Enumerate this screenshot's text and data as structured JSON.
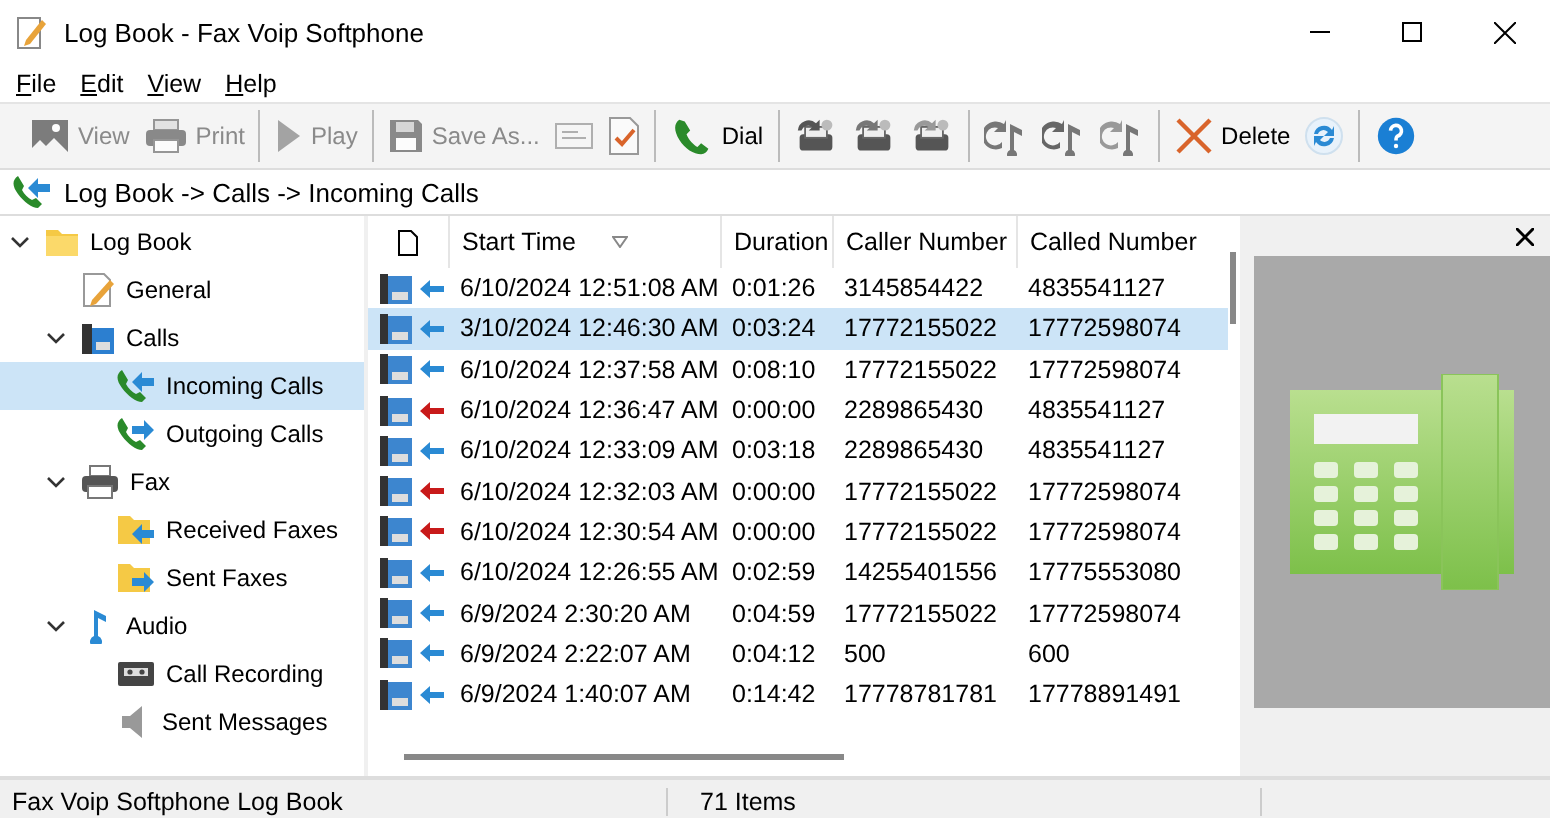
{
  "window": {
    "title": "Log Book - Fax Voip Softphone"
  },
  "menu": [
    {
      "label": "File"
    },
    {
      "label": "Edit"
    },
    {
      "label": "View"
    },
    {
      "label": "Help"
    }
  ],
  "toolbar": [
    {
      "kind": "view",
      "label": "View",
      "disabled": true
    },
    {
      "kind": "print",
      "label": "Print",
      "disabled": true
    },
    {
      "kind": "separator"
    },
    {
      "kind": "play",
      "label": "Play",
      "disabled": true
    },
    {
      "kind": "separator"
    },
    {
      "kind": "save",
      "label": "Save As...",
      "disabled": true
    },
    {
      "kind": "card",
      "disabled": true
    },
    {
      "kind": "check",
      "disabled": false
    },
    {
      "kind": "separator"
    },
    {
      "kind": "dial",
      "label": "Dial",
      "disabled": false
    },
    {
      "kind": "separator"
    },
    {
      "kind": "fax-new",
      "disabled": false
    },
    {
      "kind": "fax-redo",
      "disabled": false
    },
    {
      "kind": "fax-forward",
      "disabled": false
    },
    {
      "kind": "separator"
    },
    {
      "kind": "audio-new",
      "disabled": false
    },
    {
      "kind": "audio-redo",
      "disabled": false
    },
    {
      "kind": "audio-forward",
      "disabled": false
    },
    {
      "kind": "separator"
    },
    {
      "kind": "delete",
      "label": "Delete",
      "disabled": false
    },
    {
      "kind": "refresh",
      "disabled": false
    },
    {
      "kind": "separator"
    },
    {
      "kind": "help",
      "disabled": false
    }
  ],
  "breadcrumb": "Log Book -> Calls -> Incoming Calls",
  "tree": [
    {
      "label": "Log Book",
      "kind": "folder",
      "expanded": true,
      "selected": false,
      "children": [
        {
          "label": "General",
          "kind": "note",
          "selected": false
        },
        {
          "label": "Calls",
          "kind": "phone",
          "expanded": true,
          "selected": false,
          "children": [
            {
              "label": "Incoming Calls",
              "kind": "incoming",
              "selected": true
            },
            {
              "label": "Outgoing Calls",
              "kind": "outgoing",
              "selected": false
            }
          ]
        },
        {
          "label": "Fax",
          "kind": "printer",
          "expanded": true,
          "selected": false,
          "children": [
            {
              "label": "Received Faxes",
              "kind": "fax-in",
              "selected": false
            },
            {
              "label": "Sent Faxes",
              "kind": "fax-out",
              "selected": false
            }
          ]
        },
        {
          "label": "Audio",
          "kind": "audio",
          "expanded": true,
          "selected": false,
          "children": [
            {
              "label": "Call Recording",
              "kind": "tape",
              "selected": false
            },
            {
              "label": "Sent Messages",
              "kind": "speaker",
              "selected": false
            }
          ]
        }
      ]
    }
  ],
  "table": {
    "columns": [
      "Start Time",
      "Duration",
      "Caller Number",
      "Called Number"
    ],
    "rows": [
      {
        "start": "6/10/2024 12:51:08 AM",
        "duration": "0:01:26",
        "caller": "3145854422",
        "called": "4835541127",
        "missed": false,
        "selected": false
      },
      {
        "start": "3/10/2024 12:46:30 AM",
        "duration": "0:03:24",
        "caller": "17772155022",
        "called": "17772598074",
        "missed": false,
        "selected": true
      },
      {
        "start": "6/10/2024 12:37:58 AM",
        "duration": "0:08:10",
        "caller": "17772155022",
        "called": "17772598074",
        "missed": false,
        "selected": false
      },
      {
        "start": "6/10/2024 12:36:47 AM",
        "duration": "0:00:00",
        "caller": "2289865430",
        "called": "4835541127",
        "missed": true,
        "selected": false
      },
      {
        "start": "6/10/2024 12:33:09 AM",
        "duration": "0:03:18",
        "caller": "2289865430",
        "called": "4835541127",
        "missed": false,
        "selected": false
      },
      {
        "start": "6/10/2024 12:32:03 AM",
        "duration": "0:00:00",
        "caller": "17772155022",
        "called": "17772598074",
        "missed": true,
        "selected": false
      },
      {
        "start": "6/10/2024 12:30:54 AM",
        "duration": "0:00:00",
        "caller": "17772155022",
        "called": "17772598074",
        "missed": true,
        "selected": false
      },
      {
        "start": "6/10/2024 12:26:55 AM",
        "duration": "0:02:59",
        "caller": "14255401556",
        "called": "17775553080",
        "missed": false,
        "selected": false
      },
      {
        "start": "6/9/2024 2:30:20 AM",
        "duration": "0:04:59",
        "caller": "17772155022",
        "called": "17772598074",
        "missed": false,
        "selected": false
      },
      {
        "start": "6/9/2024 2:22:07 AM",
        "duration": "0:04:12",
        "caller": "500",
        "called": "600",
        "missed": false,
        "selected": false
      },
      {
        "start": "6/9/2024 1:40:07 AM",
        "duration": "0:14:42",
        "caller": "17778781781",
        "called": "17778891491",
        "missed": false,
        "selected": false
      }
    ]
  },
  "status_bar": {
    "left": "Fax Voip Softphone Log Book",
    "count": "71 Items"
  }
}
